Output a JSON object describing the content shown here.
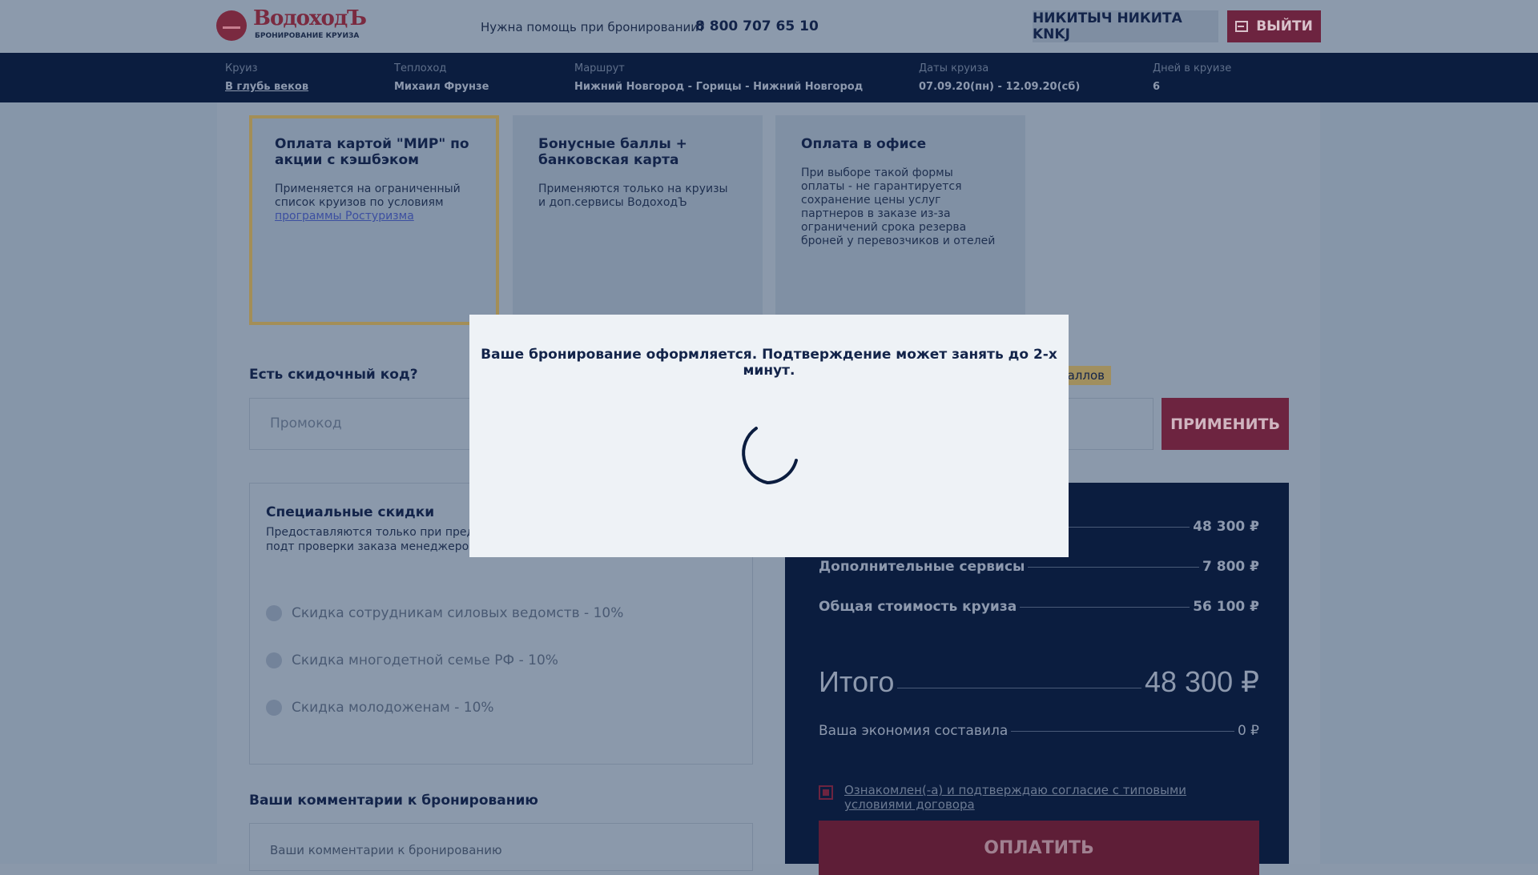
{
  "header": {
    "logo_title": "ВодоходЪ",
    "logo_subtitle": "БРОНИРОВАНИЕ КРУИЗА",
    "help_text": "Нужна помощь при бронировании?",
    "phone": "8 800 707 65 10",
    "user_name": "НИКИТЫЧ НИКИТА KNKJ",
    "logout_label": "ВЫЙТИ"
  },
  "cruise_info": [
    {
      "label": "Круиз",
      "value": "В глубь веков"
    },
    {
      "label": "Теплоход",
      "value": "Михаил Фрунзе"
    },
    {
      "label": "Маршрут",
      "value": "Нижний Новгород - Горицы - Нижний Новгород"
    },
    {
      "label": "Даты круиза",
      "value": "07.09.20(пн) - 12.09.20(сб)"
    },
    {
      "label": "Дней в круизе",
      "value": "6"
    }
  ],
  "payment_options": [
    {
      "title": "Оплата картой \"МИР\" по акции с кэшбэком",
      "desc": "Применяется на ограниченный список круизов по условиям",
      "link": "программы Ростуризма"
    },
    {
      "title": "Бонусные баллы + банковская карта",
      "desc": "Применяются только на круизы и доп.сервисы ВодоходЪ"
    },
    {
      "title": "Оплата в офисе",
      "desc": "При выборе такой формы оплаты - не гарантируется сохранение цены услуг партнеров в заказе из-за ограничений срока резерва броней у перевозчиков и отелей"
    }
  ],
  "promo": {
    "label": "Есть скидочный код?",
    "placeholder": "Промокод",
    "bonus_badge": "аллов",
    "apply_label": "ПРИМЕНИТЬ"
  },
  "discounts": {
    "title": "Специальные скидки",
    "desc": "Предоставляются только при предъя документа, не суммируются. Для подт проверки заказа менеджером",
    "items": [
      "Скидка сотрудникам силовых ведомств - 10%",
      "Скидка многодетной семье РФ - 10%",
      "Скидка молодоженам - 10%"
    ]
  },
  "comments": {
    "label": "Ваши комментарии к бронированию",
    "placeholder": "Ваши комментарии к бронированию"
  },
  "summary": {
    "row1_value": "48 300 ₽",
    "services_label": "Дополнительные сервисы",
    "services_value": "7 800 ₽",
    "cost_label": "Общая стоимость круиза",
    "cost_value": "56 100 ₽",
    "total_label": "Итого",
    "total_value": "48 300 ₽",
    "saving_label": "Ваша экономия составила",
    "saving_value": "0 ₽",
    "agree_text": "Ознакомлен(-а) и подтверждаю согласие с типовыми условиями договора",
    "pay_label": "ОПЛАТИТЬ"
  },
  "modal": {
    "message": "Ваше бронирование оформляется. Подтверждение может занять до 2-х минут."
  },
  "colors": {
    "brand_dark": "#0b1d3f",
    "brand_accent": "#6d2440",
    "modal_bg": "#eef2f6"
  }
}
